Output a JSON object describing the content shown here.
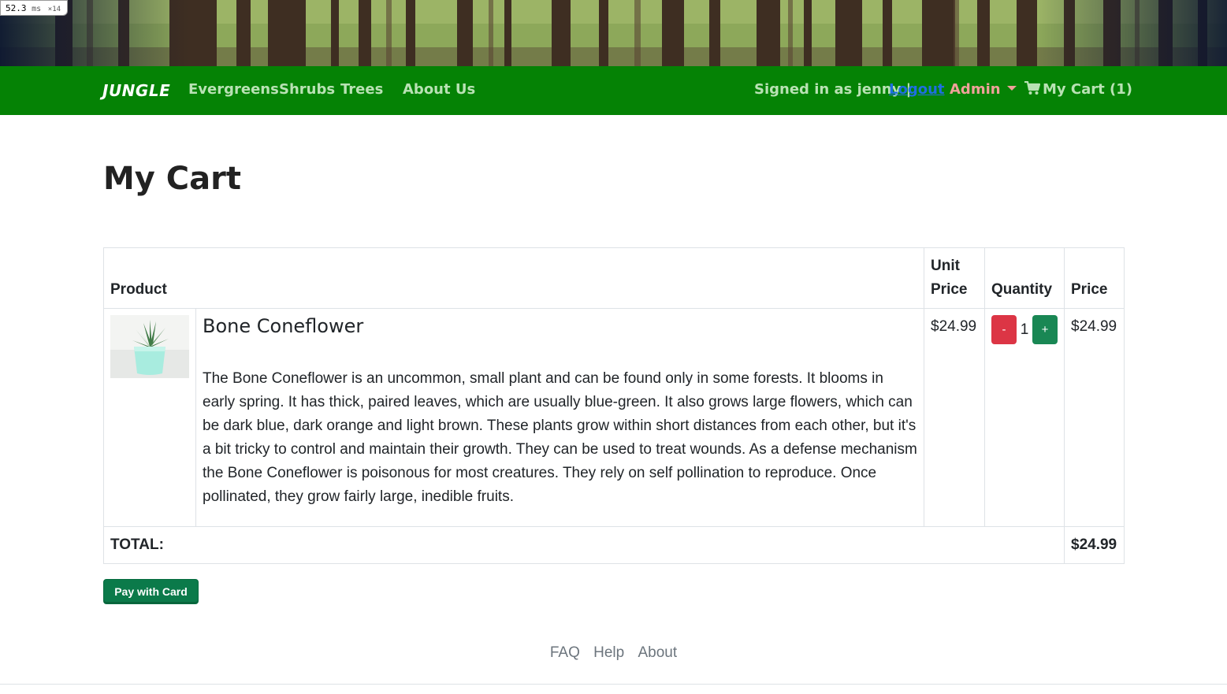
{
  "perf": {
    "value": "52.3",
    "unit": "ms",
    "multiplier": "×14"
  },
  "navbar": {
    "brand": "JUNGLE",
    "links": [
      "Evergreens",
      "Shrubs",
      "Trees",
      "About Us"
    ],
    "signed_in_text": "Signed in as jenny |",
    "logout_label": "Logout",
    "admin_label": "Admin",
    "cart_label": "My Cart (1)",
    "colors": {
      "bar": "#058205",
      "link": "#b9e2b4",
      "admin": "#f0a29a",
      "logout": "#1e6fe0"
    }
  },
  "page": {
    "title": "My Cart"
  },
  "cart": {
    "headers": {
      "product": "Product",
      "unit_price": "Unit Price",
      "quantity": "Quantity",
      "price": "Price"
    },
    "items": [
      {
        "image_icon": "potted-succulent-image",
        "name": "Bone Coneflower",
        "description": "The Bone Coneflower is an uncommon, small plant and can be found only in some forests. It blooms in early spring. It has thick, paired leaves, which are usually blue-green. It also grows large flowers, which can be dark blue, dark orange and light brown. These plants grow within short distances from each other, but it's a bit tricky to control and maintain their growth. They can be used to treat wounds. As a defense mechanism the Bone Coneflower is poisonous for most creatures. They rely on self pollination to reproduce. Once pollinated, they grow fairly large, inedible fruits.",
        "unit_price": "$24.99",
        "quantity": "1",
        "decrement_label": "-",
        "increment_label": "+",
        "price": "$24.99"
      }
    ],
    "total_label": "TOTAL:",
    "total_value": "$24.99"
  },
  "pay_button": "Pay with Card",
  "footer": {
    "links": [
      "FAQ",
      "Help",
      "About"
    ]
  }
}
